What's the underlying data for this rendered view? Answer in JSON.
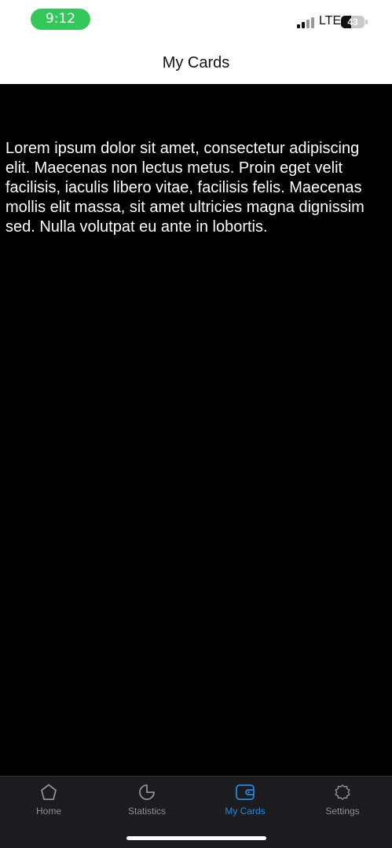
{
  "status_bar": {
    "time": "9:12",
    "network": "LTE",
    "battery": "43",
    "battery_level": 0.43
  },
  "header": {
    "title": "My Cards"
  },
  "main": {
    "body_text": "Lorem ipsum dolor sit amet, consectetur adipiscing elit. Maecenas non lectus metus. Proin eget velit facilisis, iaculis libero vitae, facilisis felis. Maecenas mollis elit massa, sit amet ultricies magna dignissim sed. Nulla volutpat eu ante in lobortis."
  },
  "tab_bar": {
    "active_color": "#1e88e5",
    "inactive_color": "#8e8e93",
    "tabs": [
      {
        "label": "Home",
        "icon": "home-icon",
        "active": false
      },
      {
        "label": "Statistics",
        "icon": "statistics-icon",
        "active": false
      },
      {
        "label": "My Cards",
        "icon": "wallet-icon",
        "active": true
      },
      {
        "label": "Settings",
        "icon": "settings-icon",
        "active": false
      }
    ]
  }
}
